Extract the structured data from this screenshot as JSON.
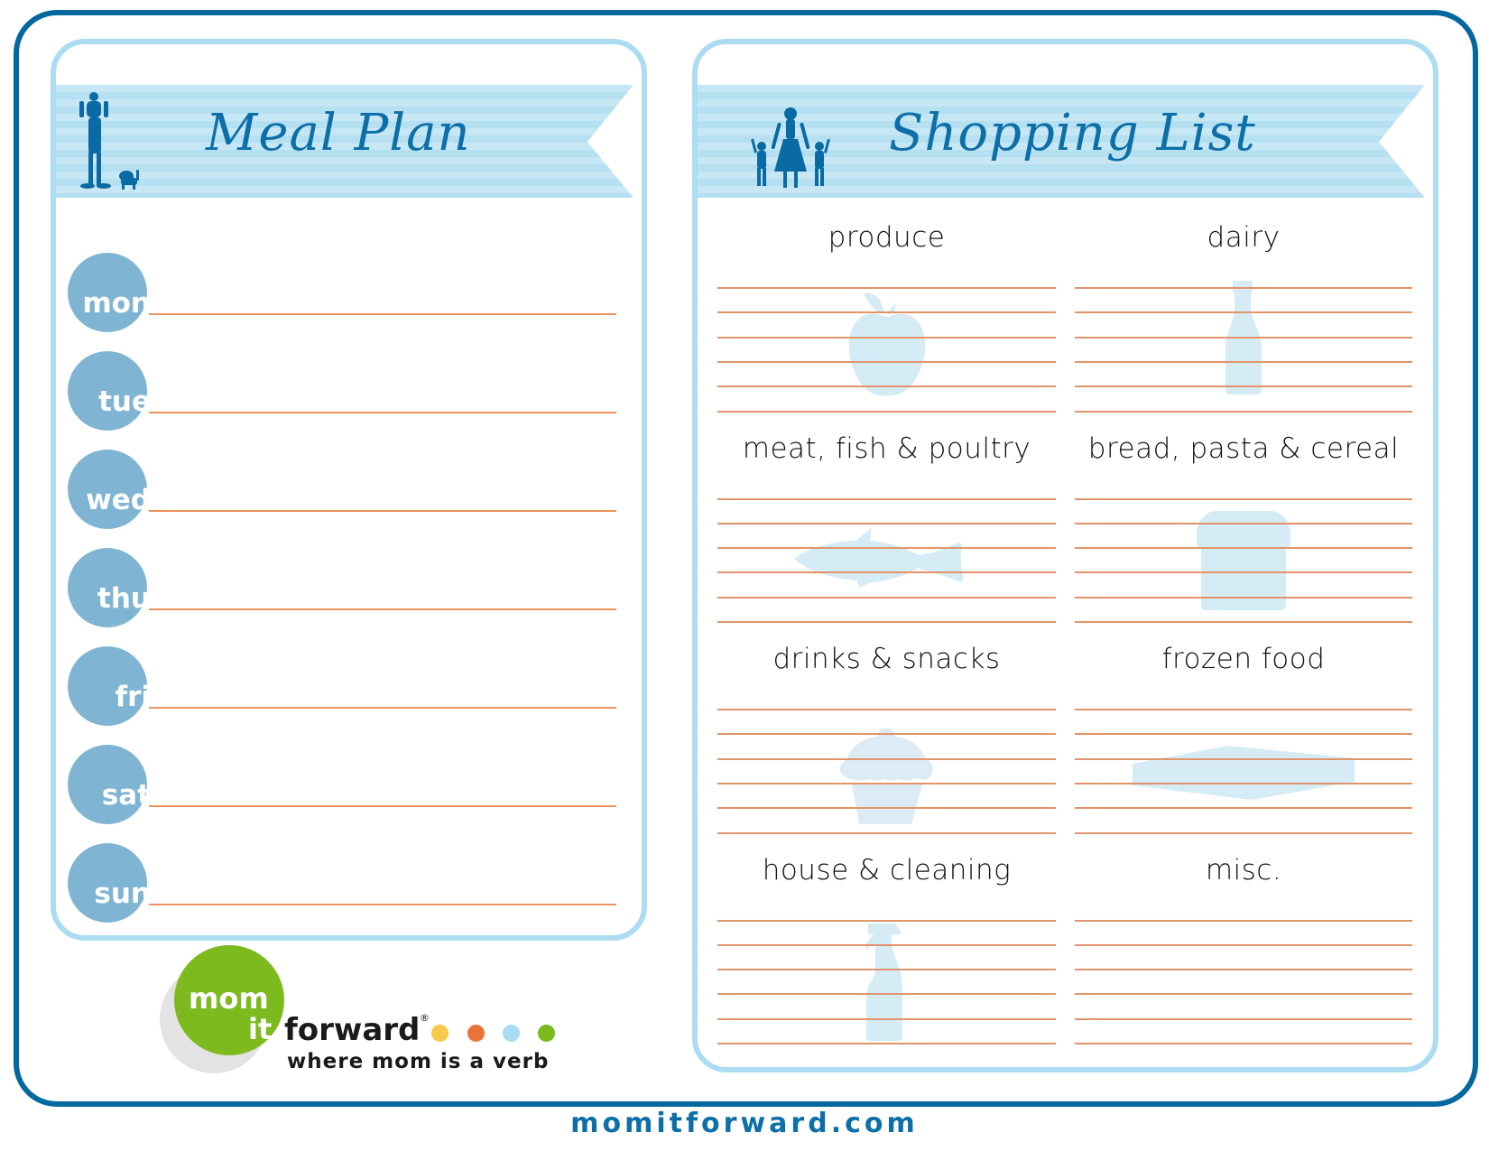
{
  "meal_plan": {
    "title": "Meal Plan",
    "days": [
      {
        "label": "mon"
      },
      {
        "label": "tue"
      },
      {
        "label": "wed"
      },
      {
        "label": "thu"
      },
      {
        "label": "fri"
      },
      {
        "label": "sat"
      },
      {
        "label": "sun"
      }
    ]
  },
  "shopping_list": {
    "title": "Shopping List",
    "categories": [
      {
        "label": "produce",
        "icon": "apple-icon"
      },
      {
        "label": "dairy",
        "icon": "milk-bottle-icon"
      },
      {
        "label": "meat, fish & poultry",
        "icon": "fish-icon"
      },
      {
        "label": "bread, pasta & cereal",
        "icon": "bread-icon"
      },
      {
        "label": "drinks & snacks",
        "icon": "cupcake-icon"
      },
      {
        "label": "frozen food",
        "icon": "frozen-box-icon"
      },
      {
        "label": "house & cleaning",
        "icon": "spray-bottle-icon"
      },
      {
        "label": "misc.",
        "icon": null
      }
    ]
  },
  "logo": {
    "word_mom": "mom",
    "word_it": "it",
    "word_forward": "forward",
    "registered": "®",
    "tagline": "where mom is a verb",
    "dot_colors": [
      "#f7c948",
      "#e8743a",
      "#a9dcf2",
      "#7cba1e"
    ]
  },
  "footer": {
    "url": "momitforward.com"
  },
  "colors": {
    "frame": "#0468a0",
    "panel_border": "#abdcf1",
    "title_blue": "#0d6fa8",
    "day_circle": "#7fb5d2",
    "line_orange": "#ef935e",
    "icon_fill": "#d5ebf6",
    "logo_green": "#7cba1e"
  }
}
